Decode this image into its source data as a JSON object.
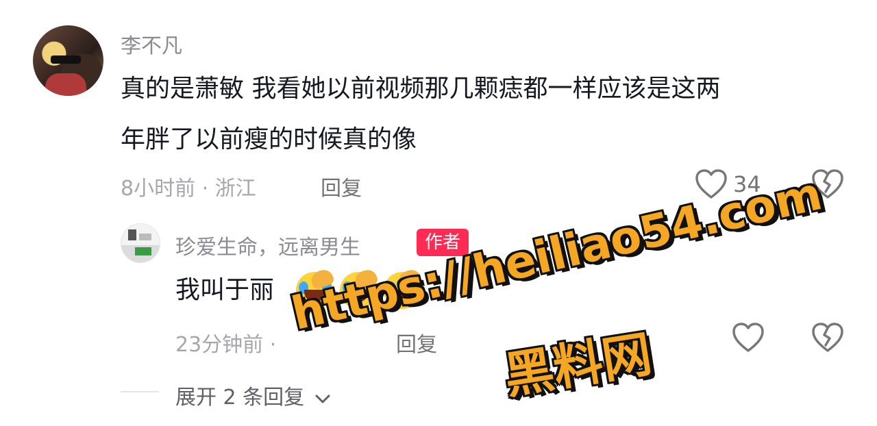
{
  "main_comment": {
    "username": "李不凡",
    "text_line1": "真的是萧敏 我看她以前视频那几颗痣都一样应该是这两",
    "text_line2": "年胖了以前瘦的时候真的像",
    "meta": "8小时前 · 浙江",
    "reply_label": "回复",
    "like_count": "34",
    "like_icon": "heart-outline-icon",
    "dislike_icon": "broken-heart-icon"
  },
  "reply_comment": {
    "username": "珍爱生命，远离男生",
    "author_badge": "作者",
    "text": "我叫于丽",
    "emojis": [
      "facepalm-crying-emoji",
      "facepalm-crying-emoji",
      "facepalm-crying-emoji"
    ],
    "meta": "23分钟前 ·",
    "reply_label": "回复",
    "like_icon": "heart-outline-icon",
    "dislike_icon": "broken-heart-icon"
  },
  "expand": {
    "label": "展开 2 条回复",
    "icon": "chevron-down-icon"
  },
  "watermark": {
    "url": "https://heiliao54.com",
    "name": "黑料网"
  },
  "colors": {
    "badge": "#fe2c55",
    "watermark_fill": "#f5a623",
    "text_primary": "#161823",
    "text_secondary": "#a6a7ab"
  }
}
